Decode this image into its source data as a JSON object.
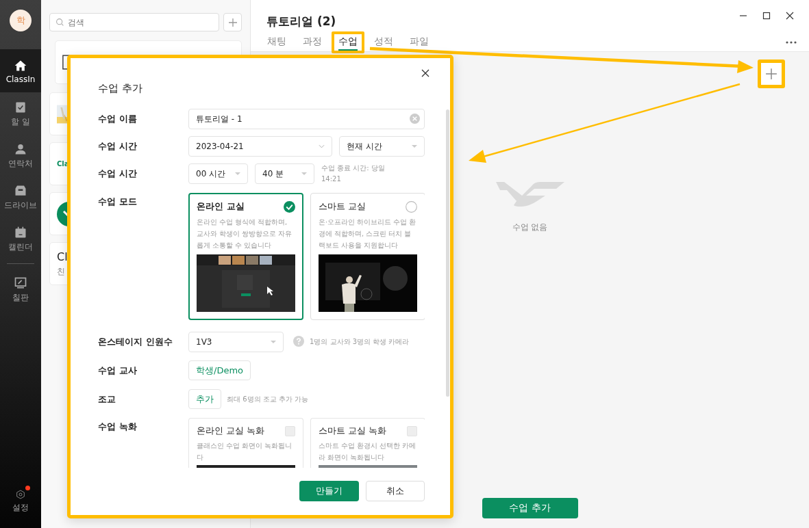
{
  "sidebar": {
    "avatar": "학",
    "items": [
      {
        "label": "ClassIn",
        "selected": true
      },
      {
        "label": "할 일",
        "selected": false
      },
      {
        "label": "연락처",
        "selected": false
      },
      {
        "label": "드라이브",
        "selected": false
      },
      {
        "label": "캘린더",
        "selected": false
      },
      {
        "label": "칠판",
        "selected": false
      }
    ],
    "settings": {
      "label": "설정",
      "notification": true
    }
  },
  "list_panel": {
    "search": {
      "placeholder": "검색"
    },
    "cards": [
      {
        "kind": "document"
      },
      {
        "kind": "thumbnail"
      },
      {
        "kind": "logo",
        "text": "Cla"
      },
      {
        "kind": "circle"
      },
      {
        "kind": "text",
        "title": "Cl",
        "subtitle": "친"
      }
    ]
  },
  "main": {
    "title": "튜토리얼 (2)",
    "tabs": [
      {
        "label": "채팅",
        "selected": false,
        "highlighted": false
      },
      {
        "label": "과정",
        "selected": false,
        "highlighted": false
      },
      {
        "label": "수업",
        "selected": true,
        "highlighted": true
      },
      {
        "label": "성적",
        "selected": false,
        "highlighted": false
      },
      {
        "label": "파일",
        "selected": false,
        "highlighted": false
      }
    ],
    "add_icon_highlighted": true,
    "empty_text": "수업 없음",
    "add_button": "수업 추가"
  },
  "dialog": {
    "title": "수업 추가",
    "rows": [
      {
        "kind": "text",
        "label": "수업 이름",
        "value": "튜토리얼 - 1"
      },
      {
        "kind": "date",
        "label": "수업 시간",
        "date": "2023-04-21",
        "time": "현재 시간"
      },
      {
        "kind": "duration",
        "label": "수업 시간",
        "hours": "00 시간",
        "minutes": "40 분",
        "note": "수업 종료 시간: 당일 14:21"
      },
      {
        "kind": "mode",
        "label": "수업 모드",
        "options": [
          {
            "title": "온라인 교실",
            "description": "온라인 수업 형식에 적합하며, 교사와 학생이 쌍방향으로 자유롭게 소통할 수 있습니다",
            "selected": true
          },
          {
            "title": "스마트 교실",
            "description": "온·오프라인 하이브리드 수업 환경에 적합하며, 스크린 터치 블랙보드 사용을 지원합니다",
            "selected": false
          }
        ]
      },
      {
        "kind": "select",
        "label": "온스테이지 인원수",
        "value": "1V3",
        "hint": "1명의 교사와 3명의 학생 카메라"
      },
      {
        "kind": "chip",
        "label": "수업 교사",
        "value": "학생/Demo"
      },
      {
        "kind": "chip",
        "label": "조교",
        "value": "추가",
        "hint": "최대 6명의 조교 추가 가능"
      },
      {
        "kind": "recording",
        "label": "수업 녹화",
        "options": [
          {
            "title": "온라인 교실 녹화",
            "description": "클래스인 수업 화면이 녹화됩니다",
            "checked": false
          },
          {
            "title": "스마트 교실 녹화",
            "description": "스마트 수업 환경시 선택한 카메라 화면이 녹화됩니다",
            "checked": false
          }
        ]
      }
    ],
    "buttons": {
      "primary": "만들기",
      "secondary": "취소"
    }
  }
}
